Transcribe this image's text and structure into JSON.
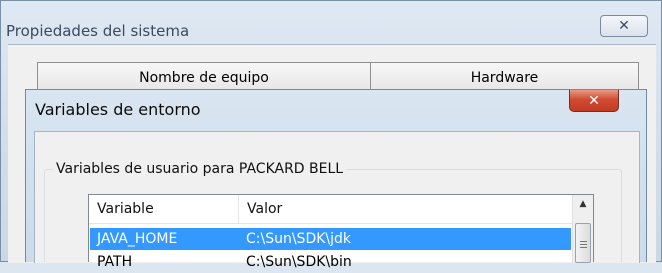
{
  "outer_window": {
    "title": "Propiedades del sistema",
    "close_symbol": "✕"
  },
  "tabs": [
    {
      "label": "Nombre de equipo"
    },
    {
      "label": "Hardware"
    }
  ],
  "dialog": {
    "title": "Variables de entorno",
    "close_symbol": "✕",
    "user_group_label": "Variables de usuario para PACKARD BELL",
    "columns": {
      "variable": "Variable",
      "value": "Valor"
    },
    "rows": [
      {
        "variable": "JAVA_HOME",
        "value": "C:\\Sun\\SDK\\jdk",
        "selected": true
      },
      {
        "variable": "PATH",
        "value": "C:\\Sun\\SDK\\bin",
        "selected": false
      }
    ]
  },
  "colors": {
    "selection": "#3399ff",
    "close_red": "#c43a22"
  },
  "icons": {
    "scroll_up": "▲"
  }
}
